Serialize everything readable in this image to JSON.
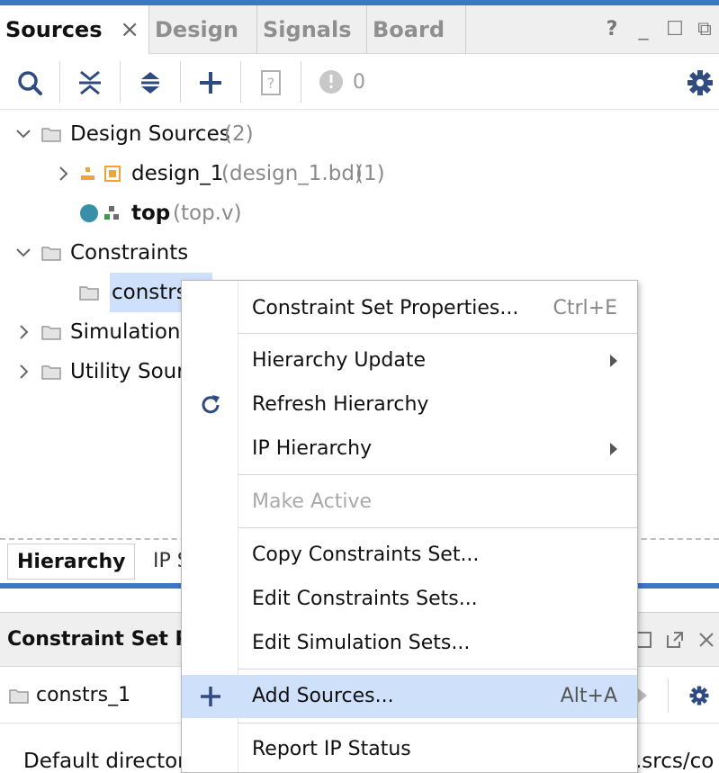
{
  "sources_panel": {
    "tabs": [
      {
        "label": "Sources",
        "active": true,
        "close": "×"
      },
      {
        "label": "Design"
      },
      {
        "label": "Signals"
      },
      {
        "label": "Board"
      }
    ],
    "window_buttons": {
      "help": "?",
      "minimize": "_",
      "maximize": "☐",
      "float": "⧉"
    },
    "toolbar": {
      "icons": [
        "search-icon",
        "collapse-all-icon",
        "expand-all-icon",
        "add-icon",
        "help-icon",
        "status-circle-icon",
        "gear-icon"
      ],
      "status_count": "0"
    },
    "tree": {
      "design_sources": {
        "label": "Design Sources",
        "count": "(2)"
      },
      "design_1": {
        "label": "design_1",
        "detail": "(design_1.bd)",
        "count": "(1)"
      },
      "top": {
        "label": "top",
        "detail": "(top.v)"
      },
      "constraints": {
        "label": "Constraints"
      },
      "constrs_1": {
        "label": "constrs_1"
      },
      "simulation": {
        "label": "Simulation Sources"
      },
      "utility": {
        "label": "Utility Sources"
      }
    },
    "bottom_tabs": [
      {
        "label": "Hierarchy",
        "active": true
      },
      {
        "label": "IP Sources"
      }
    ]
  },
  "properties_panel": {
    "title": "Constraint Set Properties",
    "object": "constrs_1",
    "directory_label": "Default directory:",
    "directory_tail": ".srcs/co"
  },
  "context_menu": {
    "items": [
      {
        "label": "Constraint Set Properties...",
        "shortcut": "Ctrl+E"
      },
      {
        "label": "Hierarchy Update",
        "submenu": true
      },
      {
        "label": "Refresh Hierarchy",
        "icon": "refresh-icon"
      },
      {
        "label": "IP Hierarchy",
        "submenu": true
      },
      {
        "label": "Make Active",
        "disabled": true
      },
      {
        "label": "Copy Constraints Set..."
      },
      {
        "label": "Edit Constraints Sets..."
      },
      {
        "label": "Edit Simulation Sets..."
      },
      {
        "label": "Add Sources...",
        "shortcut": "Alt+A",
        "icon": "add-icon",
        "hover": true
      },
      {
        "label": "Report IP Status"
      }
    ]
  },
  "colors": {
    "accent_blue": "#3f75c4",
    "icon_navy": "#2f4b80",
    "selection": "#cfe0fb",
    "teal_dot": "#3a8fa8",
    "orange_bd": "#f0a33a",
    "green_module": "#3c9a4a"
  }
}
